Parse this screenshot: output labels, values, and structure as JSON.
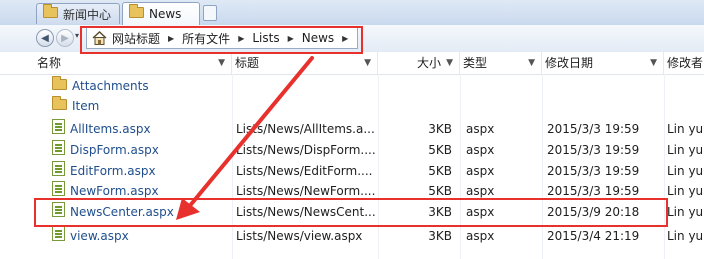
{
  "tabs": [
    {
      "label": "新闻中心",
      "active": false
    },
    {
      "label": "News",
      "active": true
    }
  ],
  "address": {
    "dropdown_caret": "▾",
    "crumbs": [
      "网站标题",
      "所有文件",
      "Lists",
      "News"
    ],
    "separator": "▶"
  },
  "columns": [
    "名称",
    "标题",
    "大小",
    "类型",
    "修改日期",
    "修改者"
  ],
  "rows": [
    {
      "icon": "folder-icon",
      "name": "Attachments",
      "title": "",
      "size": "",
      "type": "",
      "modified": "",
      "modified_by": ""
    },
    {
      "icon": "folder-icon",
      "name": "Item",
      "title": "",
      "size": "",
      "type": "",
      "modified": "",
      "modified_by": ""
    },
    {
      "icon": "aspx-file-icon",
      "name": "AllItems.aspx",
      "title": "Lists/News/AllItems.a...",
      "size": "3KB",
      "type": "aspx",
      "modified": "2015/3/3 19:59",
      "modified_by": "Lin yu"
    },
    {
      "icon": "aspx-file-icon",
      "name": "DispForm.aspx",
      "title": "Lists/News/DispForm....",
      "size": "5KB",
      "type": "aspx",
      "modified": "2015/3/3 19:59",
      "modified_by": "Lin yu"
    },
    {
      "icon": "aspx-file-icon",
      "name": "EditForm.aspx",
      "title": "Lists/News/EditForm....",
      "size": "5KB",
      "type": "aspx",
      "modified": "2015/3/3 19:59",
      "modified_by": "Lin yu"
    },
    {
      "icon": "aspx-file-icon",
      "name": "NewForm.aspx",
      "title": "Lists/News/NewForm....",
      "size": "5KB",
      "type": "aspx",
      "modified": "2015/3/3 19:59",
      "modified_by": "Lin yu"
    },
    {
      "icon": "aspx-file-icon",
      "name": "NewsCenter.aspx",
      "title": "Lists/News/NewsCent...",
      "size": "3KB",
      "type": "aspx",
      "modified": "2015/3/9 20:18",
      "modified_by": "Lin yu"
    },
    {
      "icon": "aspx-file-icon",
      "name": "view.aspx",
      "title": "Lists/News/view.aspx",
      "size": "3KB",
      "type": "aspx",
      "modified": "2015/3/4 21:19",
      "modified_by": "Lin yu"
    }
  ],
  "colors": {
    "annotation_red": "#e8302c",
    "link_blue": "#1f4e8c"
  }
}
